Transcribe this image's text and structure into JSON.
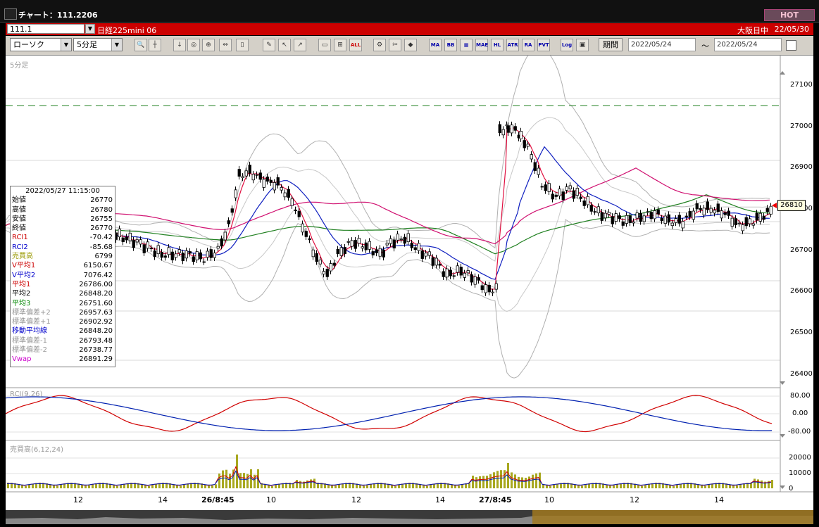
{
  "window": {
    "title": "チャート：111.2206",
    "hot_label": "HOT"
  },
  "symbol_bar": {
    "symbol": "111.1",
    "name": "日経225mini 06",
    "session": "大阪日中",
    "date": "22/05/30"
  },
  "toolbar": {
    "chart_type": "ローソク",
    "interval": "5分足",
    "indicators": [
      "MA",
      "BB",
      "MAE",
      "HL",
      "ATR",
      "RA",
      "PVT",
      "Log"
    ],
    "all_label": "ALL",
    "period_label": "期間",
    "date_from": "2022/05/24",
    "date_to": "2022/05/24",
    "tilde": "〜"
  },
  "main_panel": {
    "label": "5分足",
    "price_labels": [
      "27100",
      "27000",
      "26900",
      "26800",
      "26700",
      "26600",
      "26500",
      "26400"
    ],
    "current_price": "26810",
    "x_labels": [
      {
        "text": "12",
        "bold": false
      },
      {
        "text": "14",
        "bold": false
      },
      {
        "text": "26/8:45",
        "bold": true
      },
      {
        "text": "10",
        "bold": false
      },
      {
        "text": "12",
        "bold": false
      },
      {
        "text": "14",
        "bold": false
      },
      {
        "text": "27/8:45",
        "bold": true
      },
      {
        "text": "10",
        "bold": false
      },
      {
        "text": "12",
        "bold": false
      },
      {
        "text": "14",
        "bold": false
      }
    ]
  },
  "info_box": {
    "datetime": "2022/05/27  11:15:00",
    "rows": [
      {
        "label": "始値",
        "value": "26770",
        "color": "#000000"
      },
      {
        "label": "高値",
        "value": "26780",
        "color": "#000000"
      },
      {
        "label": "安値",
        "value": "26755",
        "color": "#000000"
      },
      {
        "label": "終値",
        "value": "26770",
        "color": "#000000"
      },
      {
        "label": "RCI1",
        "value": "-70.42",
        "color": "#cc0000"
      },
      {
        "label": "RCI2",
        "value": "-85.68",
        "color": "#0000cc"
      },
      {
        "label": "売買高",
        "value": "6799",
        "color": "#999900"
      },
      {
        "label": "V平均1",
        "value": "6150.67",
        "color": "#cc0000"
      },
      {
        "label": "V平均2",
        "value": "7076.42",
        "color": "#0000cc"
      },
      {
        "label": "平均1",
        "value": "26786.00",
        "color": "#cc0000"
      },
      {
        "label": "平均2",
        "value": "26848.20",
        "color": "#000000"
      },
      {
        "label": "平均3",
        "value": "26751.60",
        "color": "#008800"
      },
      {
        "label": "標準偏差+2",
        "value": "26957.63",
        "color": "#999999"
      },
      {
        "label": "標準偏差+1",
        "value": "26902.92",
        "color": "#999999"
      },
      {
        "label": "移動平均線",
        "value": "26848.20",
        "color": "#0000cc"
      },
      {
        "label": "標準偏差-1",
        "value": "26793.48",
        "color": "#999999"
      },
      {
        "label": "標準偏差-2",
        "value": "26738.77",
        "color": "#999999"
      },
      {
        "label": "Vwap",
        "value": "26891.29",
        "color": "#cc00cc"
      }
    ]
  },
  "rci_panel": {
    "label": "RCI(9,26)",
    "scale": [
      "80.00",
      "0.00",
      "-80.00"
    ]
  },
  "volume_panel": {
    "label": "売買高(6,12,24)",
    "scale": [
      "20000",
      "10000",
      "0"
    ]
  },
  "colors": {
    "ma_pink": "#d01070",
    "ma_blue": "#1020c0",
    "ma_green": "#208020",
    "dashed_green": "#208020",
    "volume_bar": "#a8a820"
  }
}
